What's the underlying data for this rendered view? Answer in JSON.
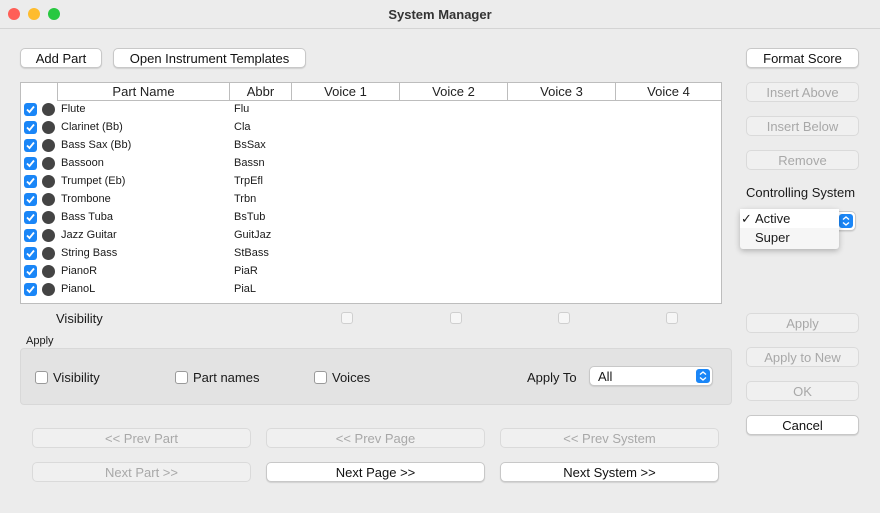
{
  "window": {
    "title": "System Manager"
  },
  "toolbar": {
    "add_part": "Add Part",
    "open_templates": "Open Instrument Templates"
  },
  "table": {
    "headers": [
      "Part Name",
      "Abbr",
      "Voice 1",
      "Voice 2",
      "Voice 3",
      "Voice 4"
    ],
    "rows": [
      {
        "name": "Flute",
        "abbr": "Flu"
      },
      {
        "name": "Clarinet (Bb)",
        "abbr": "Cla"
      },
      {
        "name": "Bass Sax (Bb)",
        "abbr": "BsSax"
      },
      {
        "name": "Bassoon",
        "abbr": "Bassn"
      },
      {
        "name": "Trumpet (Eb)",
        "abbr": "TrpEfl"
      },
      {
        "name": "Trombone",
        "abbr": "Trbn"
      },
      {
        "name": "Bass Tuba",
        "abbr": "BsTub"
      },
      {
        "name": "Jazz Guitar",
        "abbr": "GuitJaz"
      },
      {
        "name": "String Bass",
        "abbr": "StBass"
      },
      {
        "name": "PianoR",
        "abbr": "PiaR"
      },
      {
        "name": "PianoL",
        "abbr": "PiaL"
      }
    ]
  },
  "visibility_label": "Visibility",
  "apply_group": {
    "title": "Apply",
    "visibility": "Visibility",
    "part_names": "Part names",
    "voices": "Voices",
    "apply_to_label": "Apply To",
    "apply_to_value": "All"
  },
  "nav": {
    "prev_part": "<< Prev Part",
    "prev_page": "<< Prev Page",
    "prev_system": "<< Prev System",
    "next_part": "Next Part >>",
    "next_page": "Next Page >>",
    "next_system": "Next System >>"
  },
  "side": {
    "format_score": "Format Score",
    "insert_above": "Insert Above",
    "insert_below": "Insert Below",
    "remove": "Remove",
    "controlling_label": "Controlling System",
    "options": [
      "Active",
      "Super"
    ],
    "checkmark": "✓",
    "apply": "Apply",
    "apply_to_new": "Apply to New",
    "ok": "OK",
    "cancel": "Cancel"
  },
  "colors": {
    "accent": "#1a86f7",
    "close": "#ff5f57",
    "minimize": "#febc2e",
    "zoom": "#28c840"
  }
}
